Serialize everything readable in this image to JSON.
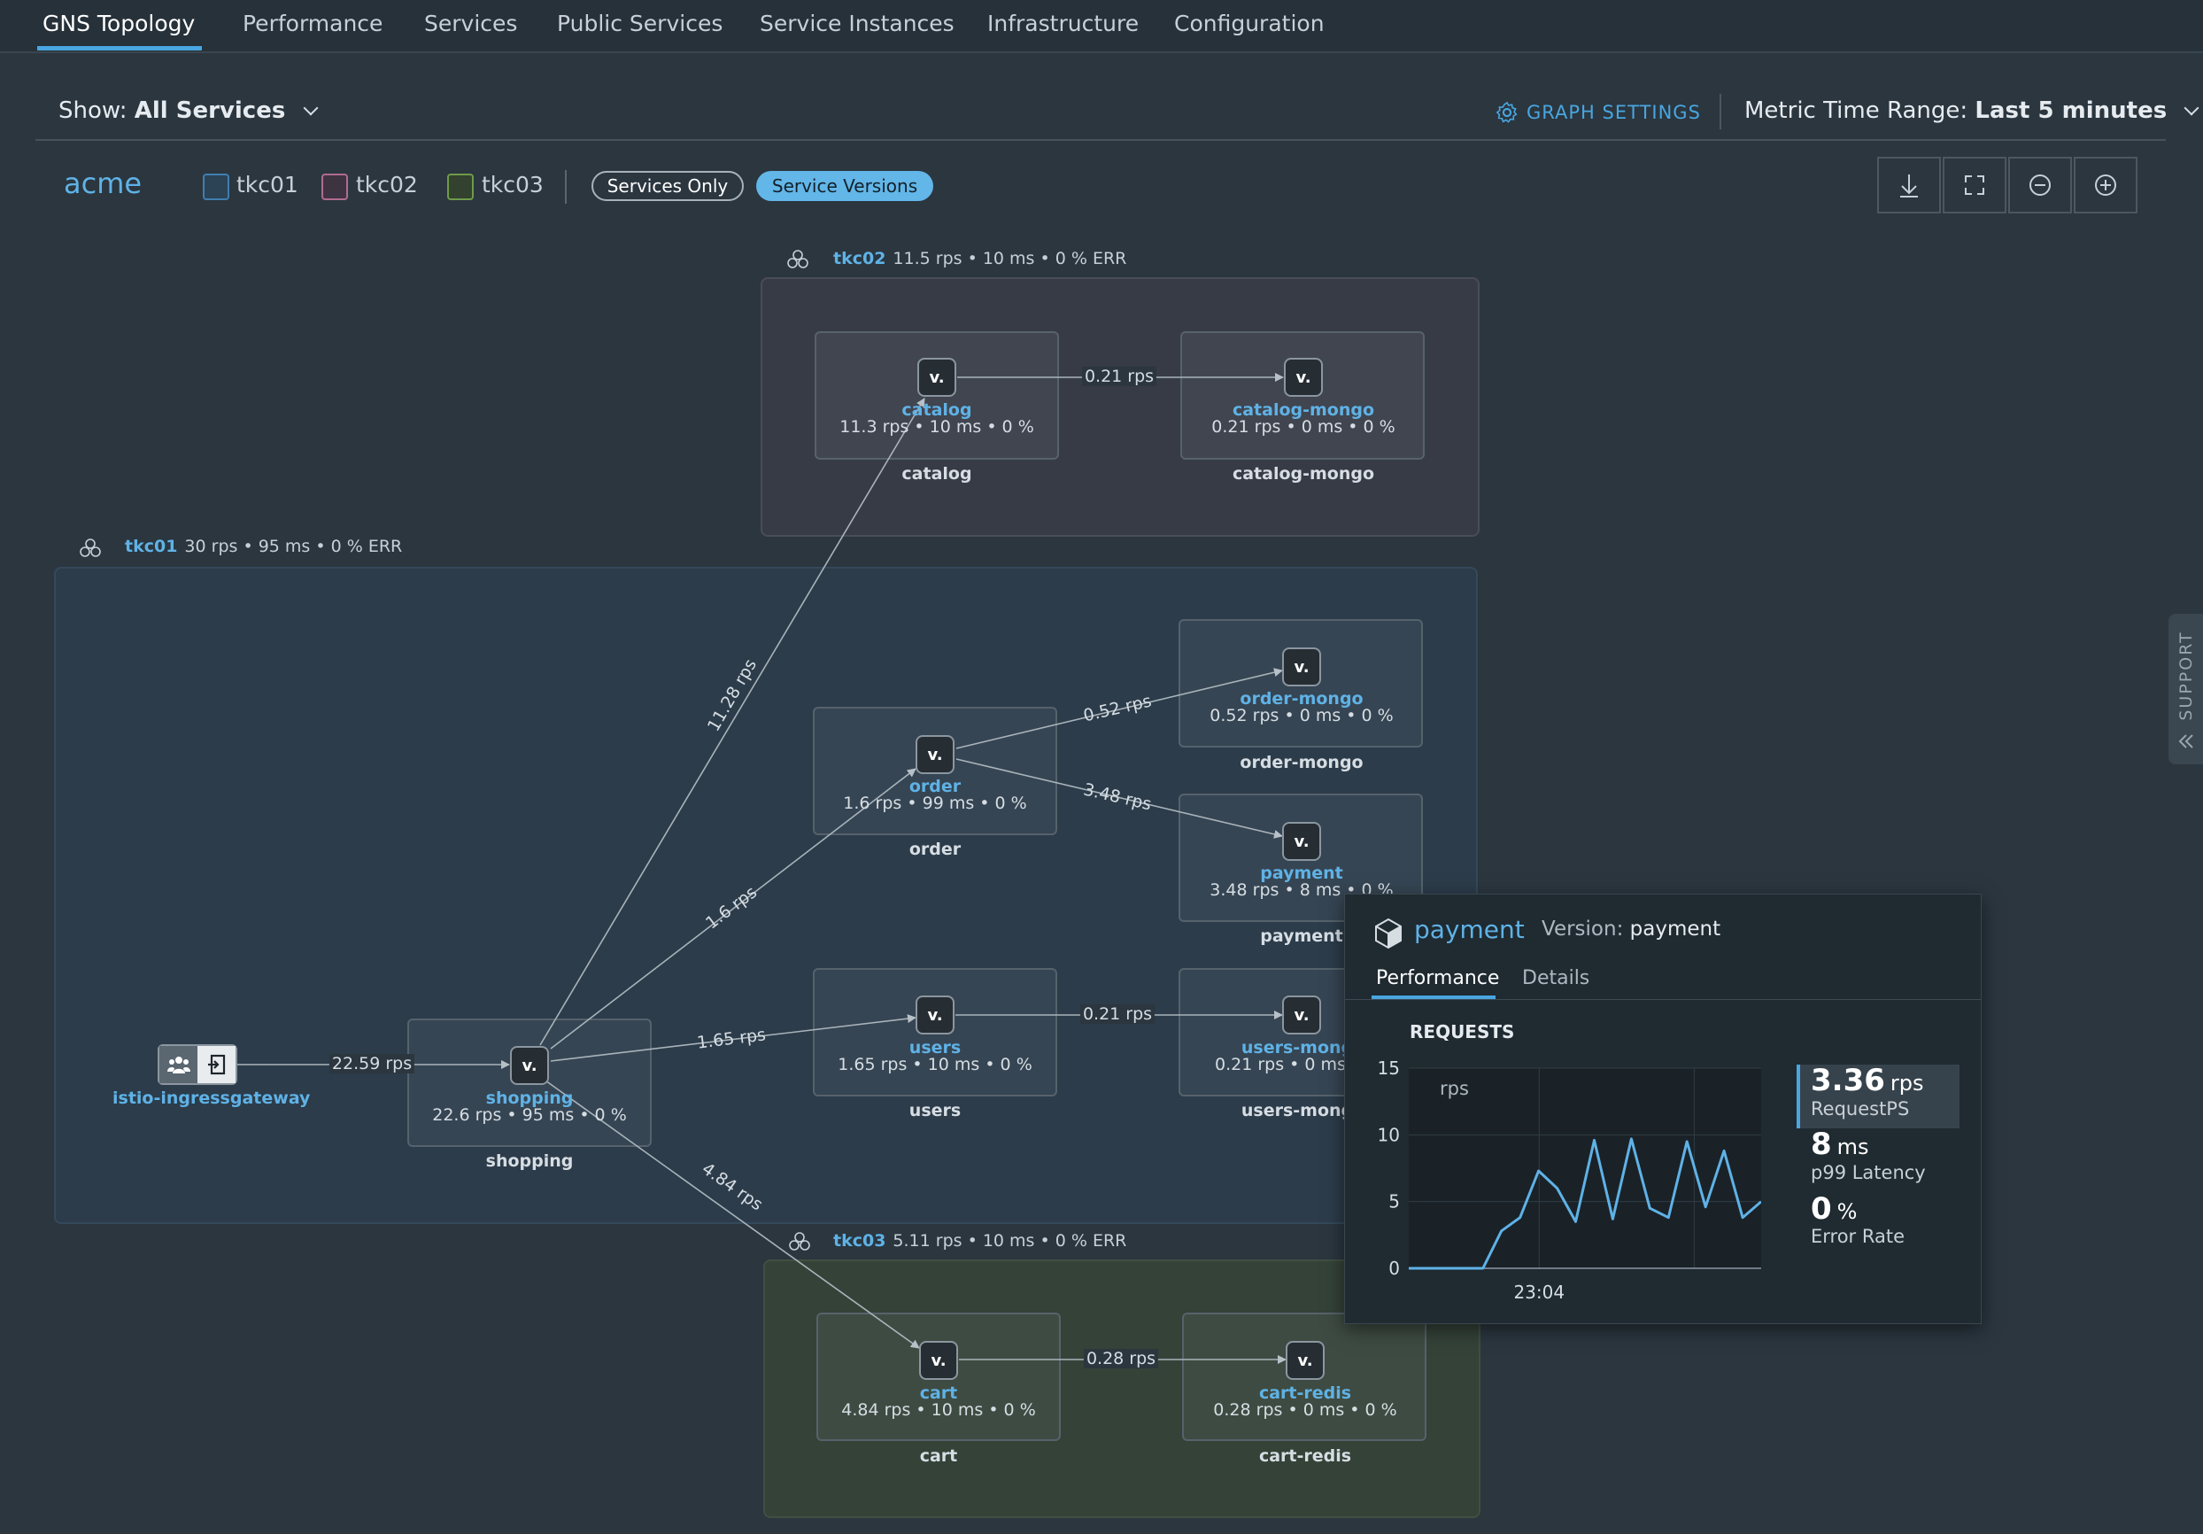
{
  "nav": {
    "tabs": [
      {
        "label": "GNS Topology"
      },
      {
        "label": "Performance"
      },
      {
        "label": "Services"
      },
      {
        "label": "Public Services"
      },
      {
        "label": "Service Instances"
      },
      {
        "label": "Infrastructure"
      },
      {
        "label": "Configuration"
      }
    ],
    "active_tab": "GNS Topology"
  },
  "toolbar": {
    "show_label": "Show:",
    "show_value": "All Services",
    "graph_settings": "GRAPH SETTINGS",
    "metric_range_label": "Metric Time Range:",
    "metric_range_value": "Last 5 minutes"
  },
  "legend": {
    "gns_name": "acme",
    "clusters": [
      {
        "name": "tkc01",
        "color": "#3f7eb0"
      },
      {
        "name": "tkc02",
        "color": "#b06c8f"
      },
      {
        "name": "tkc03",
        "color": "#6e9b4a"
      }
    ],
    "services_only": "Services Only",
    "service_versions": "Service Versions"
  },
  "graph_tools": [
    "download-icon",
    "fit-screen-icon",
    "zoom-out-icon",
    "zoom-in-icon"
  ],
  "groups": {
    "tkc02": {
      "name": "tkc02",
      "stats": "11.5 rps • 10 ms • 0 % ERR"
    },
    "tkc01": {
      "name": "tkc01",
      "stats": "30 rps • 95 ms • 0 % ERR"
    },
    "tkc03": {
      "name": "tkc03",
      "stats": "5.11 rps • 10 ms • 0 % ERR"
    }
  },
  "node_version_badge": "v.",
  "nodes": {
    "catalog": {
      "name": "catalog",
      "stats": "11.3 rps • 10 ms • 0 %",
      "label": "catalog"
    },
    "catalog_mongo": {
      "name": "catalog-mongo",
      "stats": "0.21 rps • 0 ms • 0 %",
      "label": "catalog-mongo"
    },
    "order_mongo": {
      "name": "order-mongo",
      "stats": "0.52 rps • 0 ms • 0 %",
      "label": "order-mongo"
    },
    "order": {
      "name": "order",
      "stats": "1.6 rps • 99 ms • 0 %",
      "label": "order"
    },
    "payment": {
      "name": "payment",
      "stats": "3.48 rps • 8 ms • 0 %",
      "label": "payment"
    },
    "users": {
      "name": "users",
      "stats": "1.65 rps • 10 ms • 0 %",
      "label": "users"
    },
    "users_mongo": {
      "name": "users-mong",
      "stats": "0.21 rps • 0 ms",
      "label": "users-mong"
    },
    "shopping": {
      "name": "shopping",
      "stats": "22.6 rps • 95 ms • 0 %",
      "label": "shopping"
    },
    "cart": {
      "name": "cart",
      "stats": "4.84 rps • 10 ms • 0 %",
      "label": "cart"
    },
    "cart_redis": {
      "name": "cart-redis",
      "stats": "0.28 rps • 0 ms • 0 %",
      "label": "cart-redis"
    },
    "gateway": {
      "name": "istio-ingressgateway"
    }
  },
  "edges": {
    "catalog_to_mongo": "0.21 rps",
    "shopping_to_catalog": "11.28 rps",
    "order_to_mongo": "0.52 rps",
    "order_to_payment": "3.48 rps",
    "shopping_to_order": "1.6 rps",
    "shopping_to_users": "1.65 rps",
    "users_to_mongo": "0.21 rps",
    "gateway_to_shopping": "22.59 rps",
    "shopping_to_cart": "4.84 rps",
    "cart_to_redis": "0.28 rps"
  },
  "support": {
    "label": "SUPPORT"
  },
  "popup": {
    "service": "payment",
    "version_label": "Version:",
    "version_value": "payment",
    "tabs": [
      "Performance",
      "Details"
    ],
    "section": "REQUESTS",
    "metrics": [
      {
        "value": "3.36",
        "unit": "rps",
        "name": "RequestPS"
      },
      {
        "value": "8",
        "unit": "ms",
        "name": "p99 Latency"
      },
      {
        "value": "0",
        "unit": "%",
        "name": "Error Rate"
      }
    ]
  },
  "chart_data": {
    "type": "line",
    "title": "REQUESTS",
    "ylabel": "rps",
    "xlabel": "",
    "x_tick_labels": [
      "23:04"
    ],
    "y_ticks": [
      0,
      5,
      10,
      15
    ],
    "ylim": [
      0,
      15
    ],
    "grid": true,
    "series": [
      {
        "values": [
          0,
          0,
          0,
          0,
          0,
          2.8,
          3.8,
          7.3,
          6,
          3.5,
          9.6,
          3.7,
          9.7,
          4.5,
          3.8,
          9.5,
          4.6,
          8.8,
          3.8,
          5
        ]
      }
    ]
  }
}
